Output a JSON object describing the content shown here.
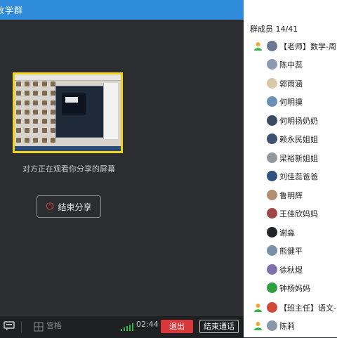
{
  "window": {
    "title": "数学群"
  },
  "share": {
    "status_text": "对方正在观看你分享的屏幕",
    "end_share_label": "结束分享"
  },
  "toolbar": {
    "grid_label": "宫格",
    "timer": "02:44",
    "exit_label": "退出",
    "end_call_label": "结束通话"
  },
  "sidebar": {
    "member_count": "群成员 14/41",
    "groups": [
      {
        "label": "【老师】数学-周",
        "color": "#6b7a90"
      },
      {
        "label": "【班主任】语文-",
        "color": "#d04a3a"
      }
    ],
    "members": [
      {
        "name": "陈中蕊",
        "color": "#8a9ab0"
      },
      {
        "name": "郭雨涵",
        "color": "#d8c8a8"
      },
      {
        "name": "何明摸",
        "color": "#6a90b8"
      },
      {
        "name": "何明扬奶奶",
        "color": "#3a4a60"
      },
      {
        "name": "赖永民姐姐",
        "color": "#405070"
      },
      {
        "name": "梁裕新姐姐",
        "color": "#9098a0"
      },
      {
        "name": "刘佳蕊爸爸",
        "color": "#305080"
      },
      {
        "name": "鲁明辉",
        "color": "#b09070"
      },
      {
        "name": "王佳欣妈妈",
        "color": "#a04848"
      },
      {
        "name": "谢淼",
        "color": "#202428"
      },
      {
        "name": "熊健平",
        "color": "#7890a8"
      },
      {
        "name": "徐秋煜",
        "color": "#8070b0"
      },
      {
        "name": "钟杨妈妈",
        "color": "#30a040"
      },
      {
        "name": "陈莉",
        "color": "#8898a8"
      }
    ]
  }
}
